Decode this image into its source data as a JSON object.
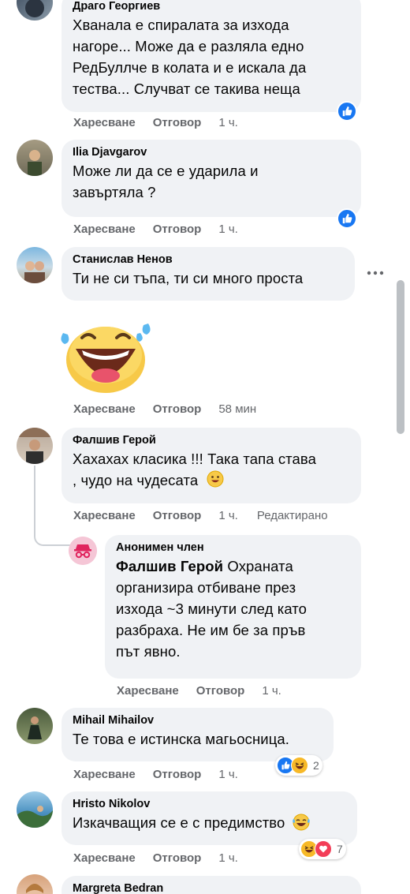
{
  "comments": [
    {
      "author": "Драго Георгиев",
      "lines": [
        "Хванала е спиралата за изхода",
        "нагоре... Може да е разляла едно",
        "РедБуллче в колата и е искала да",
        "тества... Случват се такива неща"
      ],
      "like": "Харесване",
      "reply": "Отговор",
      "time": "1 ч."
    },
    {
      "author": "Ilia Djavgarov",
      "lines": [
        "Може ли да се е ударила и",
        "завъртяла ?"
      ],
      "like": "Харесване",
      "reply": "Отговор",
      "time": "1 ч."
    },
    {
      "author": "Станислав Ненов",
      "lines": [
        "Ти не си тъпа, ти си много проста"
      ],
      "like": "Харесване",
      "reply": "Отговор",
      "time": "58 мин"
    },
    {
      "author": "Фалшив Герой",
      "lines": [
        "Хахахах класика !!! Така тапа става",
        ", чудо на чудесата"
      ],
      "like": "Харесване",
      "reply": "Отговор",
      "time": "1 ч.",
      "edited": "Редактирано"
    },
    {
      "author": "Анонимен член",
      "mention": "Фалшив Герой",
      "lines": [
        "Охраната",
        "организира отбиване през",
        "изхода ~3 минути след като",
        "разбраха. Не им бе за пръв",
        "път явно."
      ],
      "like": "Харесване",
      "reply": "Отговор",
      "time": "1 ч."
    },
    {
      "author": "Mihail Mihailov",
      "lines": [
        "Те това е истинска магьосница."
      ],
      "like": "Харесване",
      "reply": "Отговор",
      "time": "1 ч.",
      "reaction_count": "2"
    },
    {
      "author": "Hristo Nikolov",
      "lines": [
        "Изкачващия се е с предимство"
      ],
      "like": "Харесване",
      "reply": "Отговор",
      "time": "1 ч.",
      "reaction_count": "7"
    },
    {
      "author": "Margreta Bedran"
    }
  ],
  "colors": {
    "like_blue": "#1877f2",
    "bubble": "#f0f2f5",
    "meta": "#65676b",
    "love_red": "#f33e58",
    "haha_yellow": "#f7b928"
  },
  "icons": [
    "like-icon",
    "haha-icon",
    "love-icon",
    "more-icon",
    "laughing-sticker",
    "smiley-emoji",
    "crying-laugh-emoji",
    "anonymous-icon"
  ]
}
